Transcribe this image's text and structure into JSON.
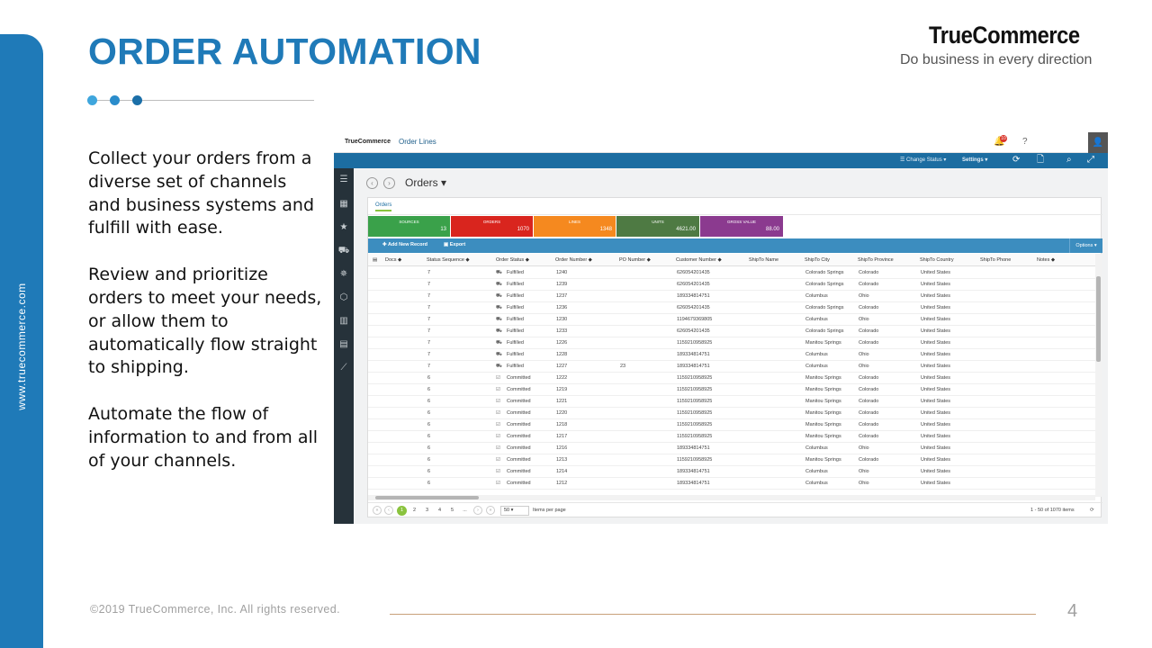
{
  "slide": {
    "title": "ORDER AUTOMATION",
    "side_url": "www.truecommerce.com",
    "brand_logo": "TrueCommerce",
    "brand_tagline": "Do business in every direction",
    "paragraphs": [
      "Collect your orders from a diverse set of channels and business systems and fulfill with ease.",
      "Review and prioritize orders to meet your needs, or allow them to automatically flow straight to shipping.",
      "Automate the flow of information to and from all of your channels."
    ],
    "copyright": "©2019 TrueCommerce, Inc. All rights reserved.",
    "page_number": "4",
    "colors": {
      "primary": "#1f7ab8",
      "dot_light": "#3fa6dd",
      "dot_mid": "#2a8ccb",
      "dot_dark": "#1b6fa8"
    }
  },
  "app": {
    "logo": "TrueCommerce",
    "page_title": "Order Lines",
    "notification_count": "10",
    "help": "?",
    "toolbar": {
      "change_status": "Change Status ▾",
      "settings": "Settings ▾"
    },
    "header": "Orders ▾",
    "tab": "Orders",
    "tiles": [
      {
        "label": "SOURCES",
        "value": "13",
        "color": "#3aa14a"
      },
      {
        "label": "ORDERS",
        "value": "1070",
        "color": "#d9251e"
      },
      {
        "label": "LINES",
        "value": "1348",
        "color": "#f5891f"
      },
      {
        "label": "UNITS",
        "value": "4621.00",
        "color": "#4e7a43"
      },
      {
        "label": "GROSS VALUE",
        "value": "88.00",
        "color": "#8b3a8f"
      }
    ],
    "actions": {
      "add": "Add New Record",
      "export": "Export",
      "options": "Options ▾"
    },
    "columns": [
      "Docs ◆",
      "Status Sequence ◆",
      "Order Status ◆",
      "Order Number ◆",
      "PO Number ◆",
      "Customer Number ◆",
      "ShipTo Name",
      "ShipTo City",
      "ShipTo Province",
      "ShipTo Country",
      "ShipTo Phone",
      "Notes ◆"
    ],
    "rows": [
      {
        "seq": "7",
        "status": "Fulfilled",
        "order": "1240",
        "po": "",
        "cust": "626054201435",
        "city": "Colorado Springs",
        "prov": "Colorado",
        "country": "United States"
      },
      {
        "seq": "7",
        "status": "Fulfilled",
        "order": "1239",
        "po": "",
        "cust": "626054201435",
        "city": "Colorado Springs",
        "prov": "Colorado",
        "country": "United States"
      },
      {
        "seq": "7",
        "status": "Fulfilled",
        "order": "1237",
        "po": "",
        "cust": "189334814751",
        "city": "Columbus",
        "prov": "Ohio",
        "country": "United States"
      },
      {
        "seq": "7",
        "status": "Fulfilled",
        "order": "1236",
        "po": "",
        "cust": "626054201435",
        "city": "Colorado Springs",
        "prov": "Colorado",
        "country": "United States"
      },
      {
        "seq": "7",
        "status": "Fulfilled",
        "order": "1230",
        "po": "",
        "cust": "1194679369805",
        "city": "Columbus",
        "prov": "Ohio",
        "country": "United States"
      },
      {
        "seq": "7",
        "status": "Fulfilled",
        "order": "1233",
        "po": "",
        "cust": "626054201435",
        "city": "Colorado Springs",
        "prov": "Colorado",
        "country": "United States"
      },
      {
        "seq": "7",
        "status": "Fulfilled",
        "order": "1226",
        "po": "",
        "cust": "1159210958925",
        "city": "Manitou Springs",
        "prov": "Colorado",
        "country": "United States"
      },
      {
        "seq": "7",
        "status": "Fulfilled",
        "order": "1228",
        "po": "",
        "cust": "189334814751",
        "city": "Columbus",
        "prov": "Ohio",
        "country": "United States"
      },
      {
        "seq": "7",
        "status": "Fulfilled",
        "order": "1227",
        "po": "23",
        "cust": "189334814751",
        "city": "Columbus",
        "prov": "Ohio",
        "country": "United States"
      },
      {
        "seq": "6",
        "status": "Committed",
        "order": "1222",
        "po": "",
        "cust": "1159210958925",
        "city": "Manitou Springs",
        "prov": "Colorado",
        "country": "United States"
      },
      {
        "seq": "6",
        "status": "Committed",
        "order": "1219",
        "po": "",
        "cust": "1159210958925",
        "city": "Manitou Springs",
        "prov": "Colorado",
        "country": "United States"
      },
      {
        "seq": "6",
        "status": "Committed",
        "order": "1221",
        "po": "",
        "cust": "1159210958925",
        "city": "Manitou Springs",
        "prov": "Colorado",
        "country": "United States"
      },
      {
        "seq": "6",
        "status": "Committed",
        "order": "1220",
        "po": "",
        "cust": "1159210958925",
        "city": "Manitou Springs",
        "prov": "Colorado",
        "country": "United States"
      },
      {
        "seq": "6",
        "status": "Committed",
        "order": "1218",
        "po": "",
        "cust": "1159210958925",
        "city": "Manitou Springs",
        "prov": "Colorado",
        "country": "United States"
      },
      {
        "seq": "6",
        "status": "Committed",
        "order": "1217",
        "po": "",
        "cust": "1159210958925",
        "city": "Manitou Springs",
        "prov": "Colorado",
        "country": "United States"
      },
      {
        "seq": "6",
        "status": "Committed",
        "order": "1216",
        "po": "",
        "cust": "189334814751",
        "city": "Columbus",
        "prov": "Ohio",
        "country": "United States"
      },
      {
        "seq": "6",
        "status": "Committed",
        "order": "1213",
        "po": "",
        "cust": "1159210958925",
        "city": "Manitou Springs",
        "prov": "Colorado",
        "country": "United States"
      },
      {
        "seq": "6",
        "status": "Committed",
        "order": "1214",
        "po": "",
        "cust": "189334814751",
        "city": "Columbus",
        "prov": "Ohio",
        "country": "United States"
      },
      {
        "seq": "6",
        "status": "Committed",
        "order": "1212",
        "po": "",
        "cust": "189334814751",
        "city": "Columbus",
        "prov": "Ohio",
        "country": "United States"
      }
    ],
    "pager": {
      "pages": [
        "1",
        "2",
        "3",
        "4",
        "5",
        "..."
      ],
      "page_size": "50 ▾",
      "items_per_page": "Items per page",
      "range": "1 - 50 of 1070 items"
    }
  }
}
